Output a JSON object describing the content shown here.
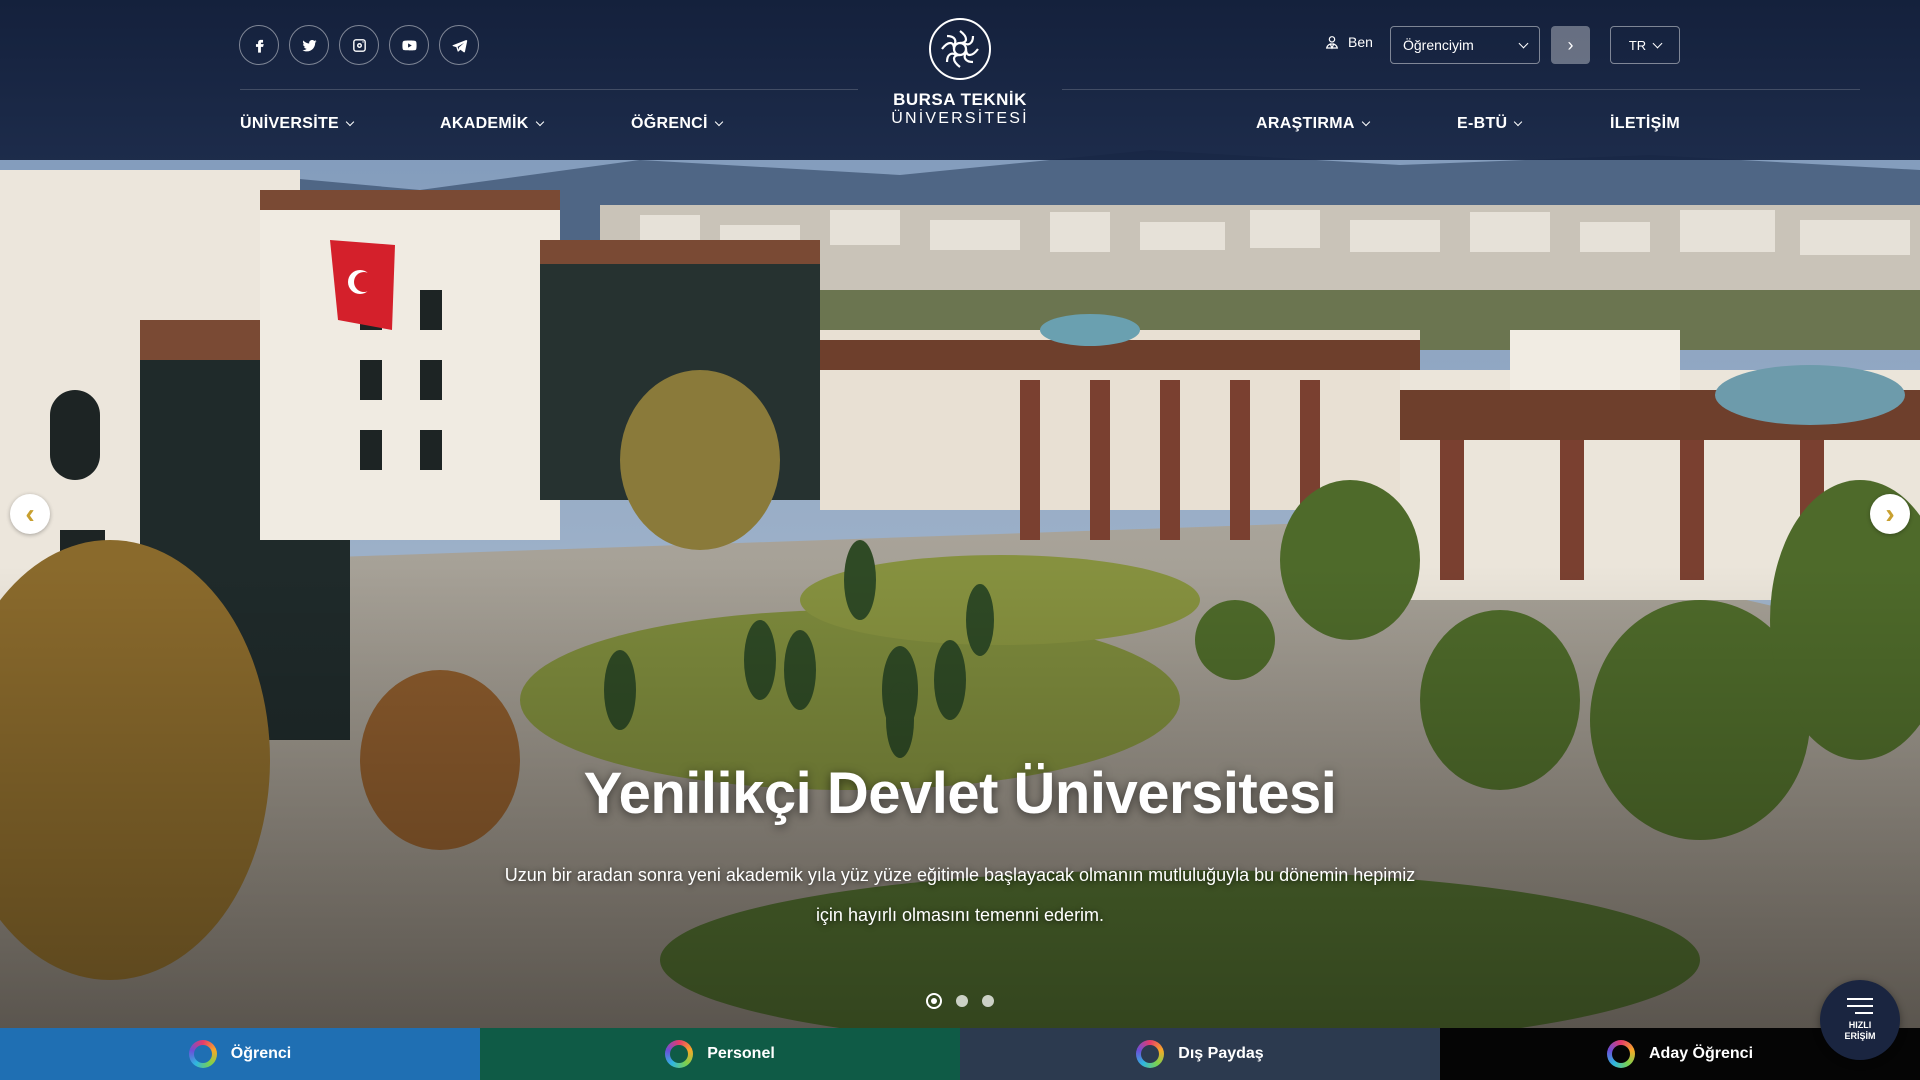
{
  "social": [
    {
      "name": "facebook-icon"
    },
    {
      "name": "twitter-icon"
    },
    {
      "name": "instagram-icon"
    },
    {
      "name": "youtube-icon"
    },
    {
      "name": "telegram-icon"
    }
  ],
  "logo": {
    "line1": "BURSA TEKNİK",
    "line2": "ÜNİVERSİTESİ"
  },
  "user_bar": {
    "ben_label": "Ben",
    "role_value": "Öğrenciyim",
    "lang_value": "TR"
  },
  "nav": {
    "universite": "ÜNİVERSİTE",
    "akademik": "AKADEMİK",
    "ogrenci": "ÖĞRENCİ",
    "arastirma": "ARAŞTIRMA",
    "ebtu": "E-BTÜ",
    "iletisim": "İLETİŞİM"
  },
  "hero": {
    "title": "Yenilikçi Devlet Üniversitesi",
    "text": "Uzun bir aradan sonra yeni akademik yıla yüz yüze eğitimle başlayacak olmanın mutluluğuyla bu dönemin hepimiz için hayırlı olmasını temenni ederim.",
    "slide_count": 3,
    "active_slide": 1
  },
  "bottom_bar": [
    {
      "label": "Öğrenci",
      "color": "#1f6fb3"
    },
    {
      "label": "Personel",
      "color": "#0f5b46"
    },
    {
      "label": "Dış Paydaş",
      "color": "#2c3a4f"
    },
    {
      "label": "Aday Öğrenci",
      "color": "#050505"
    }
  ],
  "quick_access": {
    "line1": "HIZLI",
    "line2": "ERİŞİM"
  },
  "colors": {
    "header_bg": "#131f3c",
    "arrow_accent": "#c8a030"
  }
}
